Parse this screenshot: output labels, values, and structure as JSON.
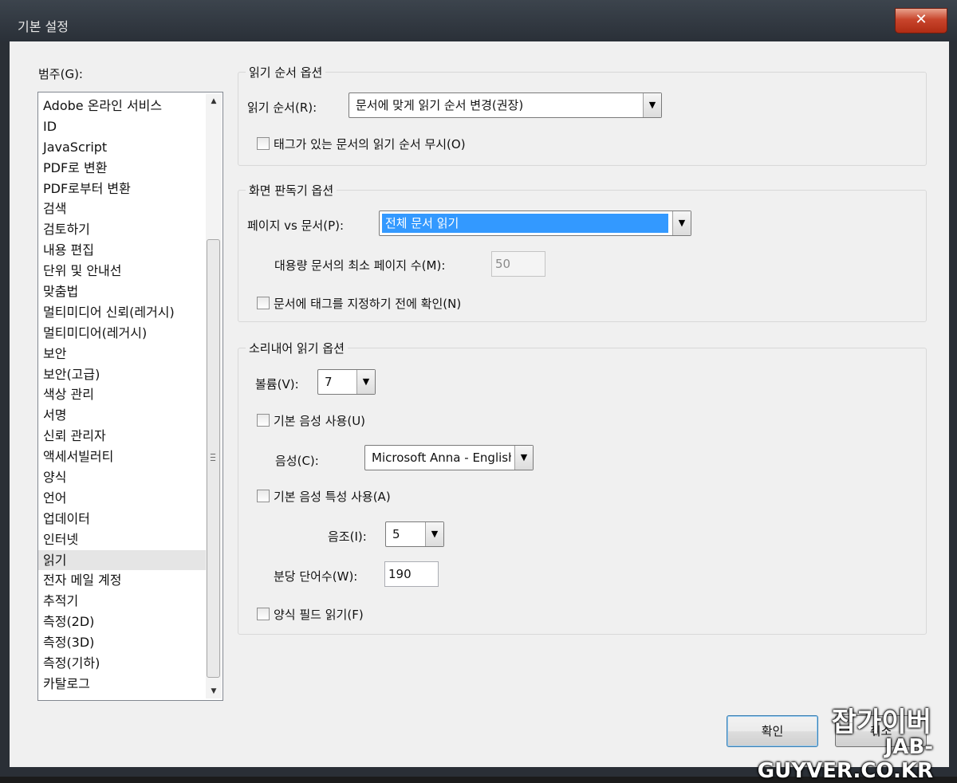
{
  "window": {
    "title": "기본 설정",
    "close_glyph": "✕"
  },
  "categories": {
    "label": "범주(G):",
    "items": [
      "Adobe 온라인 서비스",
      "ID",
      "JavaScript",
      "PDF로 변환",
      "PDF로부터 변환",
      "검색",
      "검토하기",
      "내용 편집",
      "단위 및 안내선",
      "맞춤법",
      "멀티미디어 신뢰(레거시)",
      "멀티미디어(레거시)",
      "보안",
      "보안(고급)",
      "색상 관리",
      "서명",
      "신뢰 관리자",
      "액세서빌러티",
      "양식",
      "언어",
      "업데이터",
      "인터넷",
      "읽기",
      "전자 메일 계정",
      "추적기",
      "측정(2D)",
      "측정(3D)",
      "측정(기하)",
      "카탈로그"
    ],
    "selected_index": 22
  },
  "reading_order": {
    "group_title": "읽기 순서 옵션",
    "order_label": "읽기 순서(R):",
    "order_value": "문서에 맞게 읽기 순서 변경(권장)",
    "ignore_label": "태그가 있는 문서의 읽기 순서 무시(O)"
  },
  "screen_reader": {
    "group_title": "화면 판독기 옵션",
    "page_vs_doc_label": "페이지 vs 문서(P):",
    "page_vs_doc_value": "전체 문서 읽기",
    "min_pages_label": "대용량 문서의 최소 페이지 수(M):",
    "min_pages_value": "50",
    "confirm_label": "문서에 태그를 지정하기 전에 확인(N)"
  },
  "read_aloud": {
    "group_title": "소리내어 읽기 옵션",
    "volume_label": "볼륨(V):",
    "volume_value": "7",
    "default_voice_label": "기본 음성 사용(U)",
    "voice_label": "음성(C):",
    "voice_value": "Microsoft Anna - English",
    "default_attr_label": "기본 음성 특성 사용(A)",
    "pitch_label": "음조(I):",
    "pitch_value": "5",
    "wpm_label": "분당 단어수(W):",
    "wpm_value": "190",
    "form_fields_label": "양식 필드 읽기(F)"
  },
  "buttons": {
    "ok": "확인",
    "cancel": "취소"
  },
  "watermark": {
    "line1": "잡가이버",
    "line2": "JAB-GUYVER.CO.KR"
  }
}
